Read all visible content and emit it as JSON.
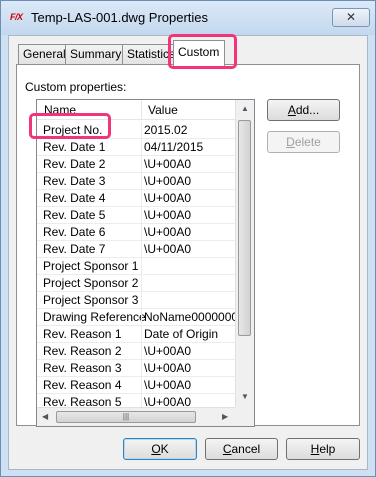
{
  "window": {
    "title": "Temp-LAS-001.dwg Properties",
    "app_icon_text": "F/X",
    "close_glyph": "✕"
  },
  "tabs": [
    {
      "label": "General"
    },
    {
      "label": "Summary"
    },
    {
      "label": "Statistics"
    },
    {
      "label": "Custom"
    }
  ],
  "custom": {
    "section_label": "Custom properties:",
    "columns": {
      "name": "Name",
      "value": "Value"
    },
    "rows": [
      {
        "name": "Project No.",
        "value": "2015.02"
      },
      {
        "name": "Rev. Date 1",
        "value": "04/11/2015"
      },
      {
        "name": "Rev. Date 2",
        "value": "\\U+00A0"
      },
      {
        "name": "Rev. Date 3",
        "value": "\\U+00A0"
      },
      {
        "name": "Rev. Date 4",
        "value": "\\U+00A0"
      },
      {
        "name": "Rev. Date 5",
        "value": "\\U+00A0"
      },
      {
        "name": "Rev. Date 6",
        "value": "\\U+00A0"
      },
      {
        "name": "Rev. Date 7",
        "value": "\\U+00A0"
      },
      {
        "name": "Project Sponsor 1",
        "value": ""
      },
      {
        "name": "Project Sponsor 2",
        "value": ""
      },
      {
        "name": "Project Sponsor 3",
        "value": ""
      },
      {
        "name": "Drawing Reference",
        "value": "NoName0000000"
      },
      {
        "name": "Rev. Reason 1",
        "value": "Date of Origin"
      },
      {
        "name": "Rev. Reason 2",
        "value": "\\U+00A0"
      },
      {
        "name": "Rev. Reason 3",
        "value": "\\U+00A0"
      },
      {
        "name": "Rev. Reason 4",
        "value": "\\U+00A0"
      },
      {
        "name": "Rev. Reason 5",
        "value": "\\U+00A0"
      }
    ],
    "add_button": {
      "mnemonic": "A",
      "rest": "dd..."
    },
    "delete_button": {
      "mnemonic": "D",
      "rest": "elete"
    }
  },
  "footer": {
    "ok": {
      "mnemonic": "O",
      "rest": "K"
    },
    "cancel": {
      "mnemonic": "C",
      "rest": "ancel"
    },
    "help": {
      "mnemonic": "H",
      "rest": "elp"
    }
  },
  "colors": {
    "highlight": "#f2347a",
    "title_bar": "#c3d8ee",
    "window_bg": "#f0f0f0"
  }
}
